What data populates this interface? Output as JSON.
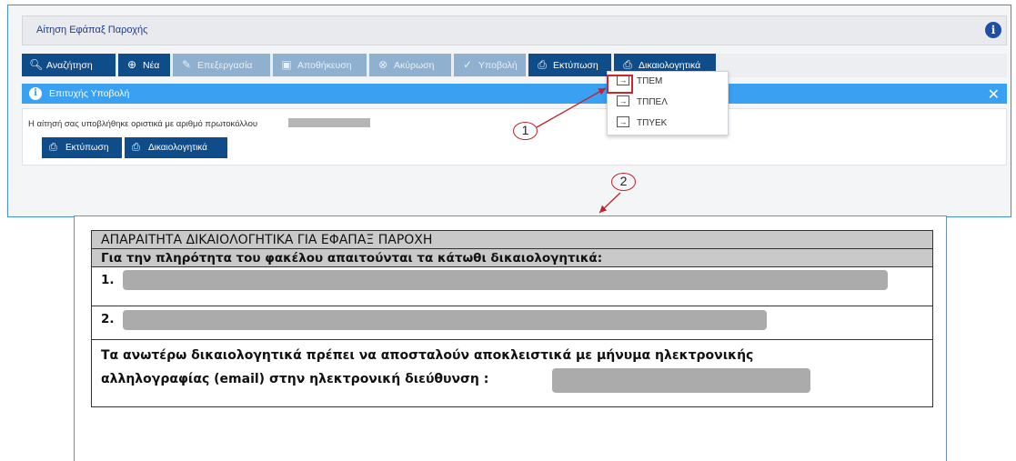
{
  "header": {
    "title": "Αίτηση Εφάπαξ Παροχής",
    "info_icon": "info-icon"
  },
  "toolbar": {
    "search": "Αναζήτηση",
    "new": "Νέα",
    "edit": "Επεξεργασία",
    "save": "Αποθήκευση",
    "cancel": "Ακύρωση",
    "submit": "Υποβολή",
    "print": "Εκτύπωση",
    "documents": "Δικαιολογητικά"
  },
  "dropdown": {
    "items": [
      "ΤΠΕΜ",
      "ΤΠΠΕΛ",
      "ΤΠΥΕΚ"
    ]
  },
  "success": {
    "title": "Επιτυχής Υποβολή",
    "close": "✕"
  },
  "message": {
    "text": "Η αίτησή σας υποβλήθηκε οριστικά με αριθμό πρωτοκόλλου",
    "print": "Εκτύπωση",
    "documents": "Δικαιολογητικά"
  },
  "annotations": {
    "one": "1",
    "two": "2",
    "color": "#c2202a"
  },
  "document": {
    "heading": "ΑΠΑΡΑΙΤΗΤΑ ΔΙΚΑΙΟΛΟΓΗΤΙΚΑ ΓΙΑ ΕΦΑΠΑΞ ΠΑΡΟΧΗ",
    "subheading": "Για την πληρότητα του φακέλου απαιτούνται τα κάτωθι δικαιολογητικά:",
    "item1": "1.",
    "item2": "2.",
    "note_line1": "Τα ανωτέρω δικαιολογητικά πρέπει να αποσταλούν αποκλειστικά με μήνυμα ηλεκτρονικής",
    "note_line2": "αλληλογραφίας (email) στην ηλεκτρονική διεύθυνση :"
  },
  "colors": {
    "primary": "#0f4c8a",
    "disabled": "#8fb0cf",
    "success": "#3aa0f2",
    "redacted": "#b5b5b5"
  }
}
